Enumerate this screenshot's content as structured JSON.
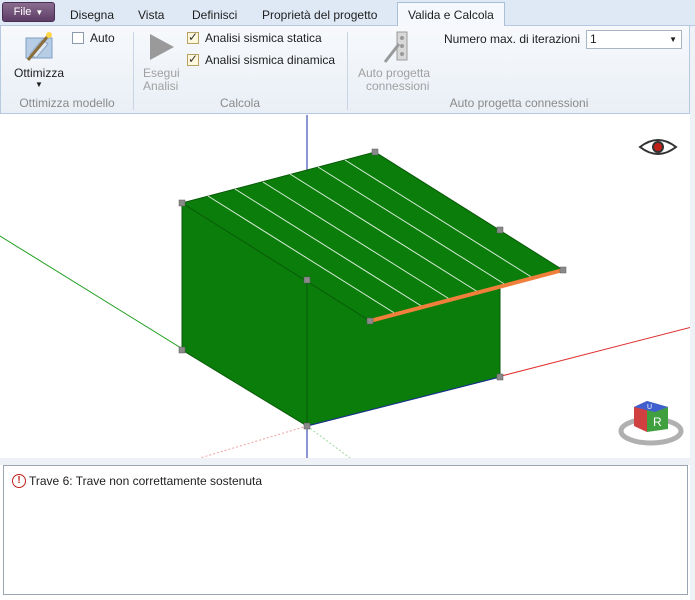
{
  "tabs": {
    "file": "File",
    "items": [
      "Disegna",
      "Vista",
      "Definisci",
      "Proprietà del progetto",
      "Valida e Calcola"
    ],
    "active": "Valida e Calcola"
  },
  "ribbon": {
    "optimize": {
      "button": "Ottimizza",
      "auto": "Auto",
      "group": "Ottimizza modello"
    },
    "calc": {
      "run_line1": "Esegui",
      "run_line2": "Analisi",
      "static": "Analisi sismica statica",
      "dynamic": "Analisi sismica dinamica",
      "group": "Calcola"
    },
    "connections": {
      "button_line1": "Auto progetta",
      "button_line2": "connessioni",
      "iter_label": "Numero max. di iterazioni",
      "iter_value": "1",
      "group": "Auto progetta connessioni"
    }
  },
  "viewcube": {
    "face_r": "R",
    "face_u": "U"
  },
  "output": {
    "message": "Trave 6: Trave non correttamente sostenuta"
  },
  "colors": {
    "accent_green": "#0a7d0a",
    "beam_orange": "#ef7f3a",
    "axis_red": "#e03030",
    "axis_green": "#20a020",
    "axis_blue": "#1a2ea0"
  }
}
